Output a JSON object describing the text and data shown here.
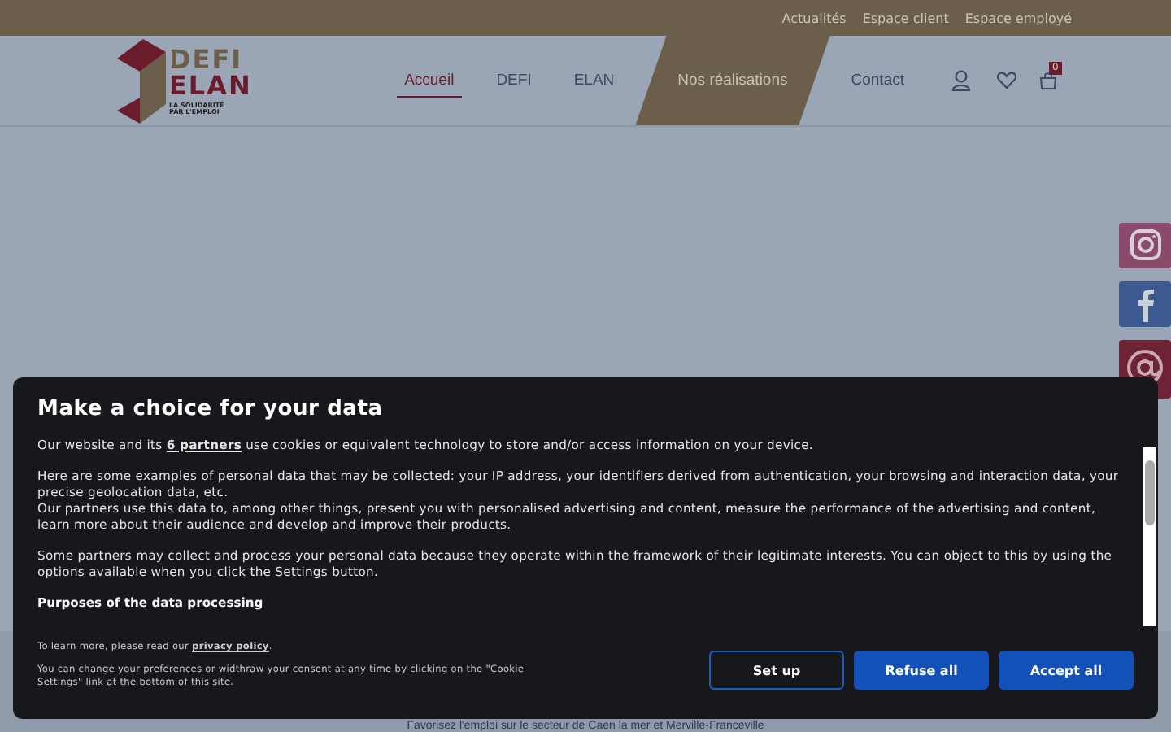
{
  "top_links": [
    "Actualités",
    "Espace client",
    "Espace employé"
  ],
  "logo": {
    "line1": "DEFI",
    "line2": "ELAN",
    "tagline1": "LA SOLIDARITÉ",
    "tagline2": "PAR L'EMPLOI"
  },
  "nav": [
    {
      "label": "Accueil",
      "selected": true,
      "highlighted": false
    },
    {
      "label": "DEFI",
      "selected": false,
      "highlighted": false
    },
    {
      "label": "ELAN",
      "selected": false,
      "highlighted": false
    },
    {
      "label": "Nos réalisations",
      "selected": false,
      "highlighted": true
    },
    {
      "label": "Contact",
      "selected": false,
      "highlighted": false
    }
  ],
  "cart_count": "0",
  "hero_title": "Favorisez l'emploi sur le secteur de Caen la mer et Merville-Franceville",
  "consent": {
    "title": "Make a choice for your data",
    "intro_before": "Our website and its ",
    "partners_link": "6 partners",
    "intro_after": " use cookies or equivalent technology to store and/or access information on your device.",
    "paragraphs": [
      "Here are some examples of personal data that may be collected: your IP address, your identifiers derived from authentication, your browsing and interaction data, your precise geolocation data, etc.",
      "Our partners use this data to, among other things, present you with personalised advertising and content, measure the performance of the advertising and content, learn more about their audience and develop and improve their products.",
      "Some partners may collect and process your personal data because they operate within the framework of their legitimate interests. You can object to this by using the options available when you click the Settings button."
    ],
    "purposes_heading": "Purposes of the data processing",
    "learn_before": "To learn more, please read our ",
    "privacy_link": "privacy policy",
    "learn_after": ".",
    "change_note": "You can change your preferences or widthraw your consent at any time by clicking on the \"Cookie Settings\" link at the bottom of this site.",
    "buttons": [
      {
        "label": "Set up",
        "kind": "outline"
      },
      {
        "label": "Refuse all",
        "kind": "solid"
      },
      {
        "label": "Accept all",
        "kind": "solid"
      }
    ]
  }
}
